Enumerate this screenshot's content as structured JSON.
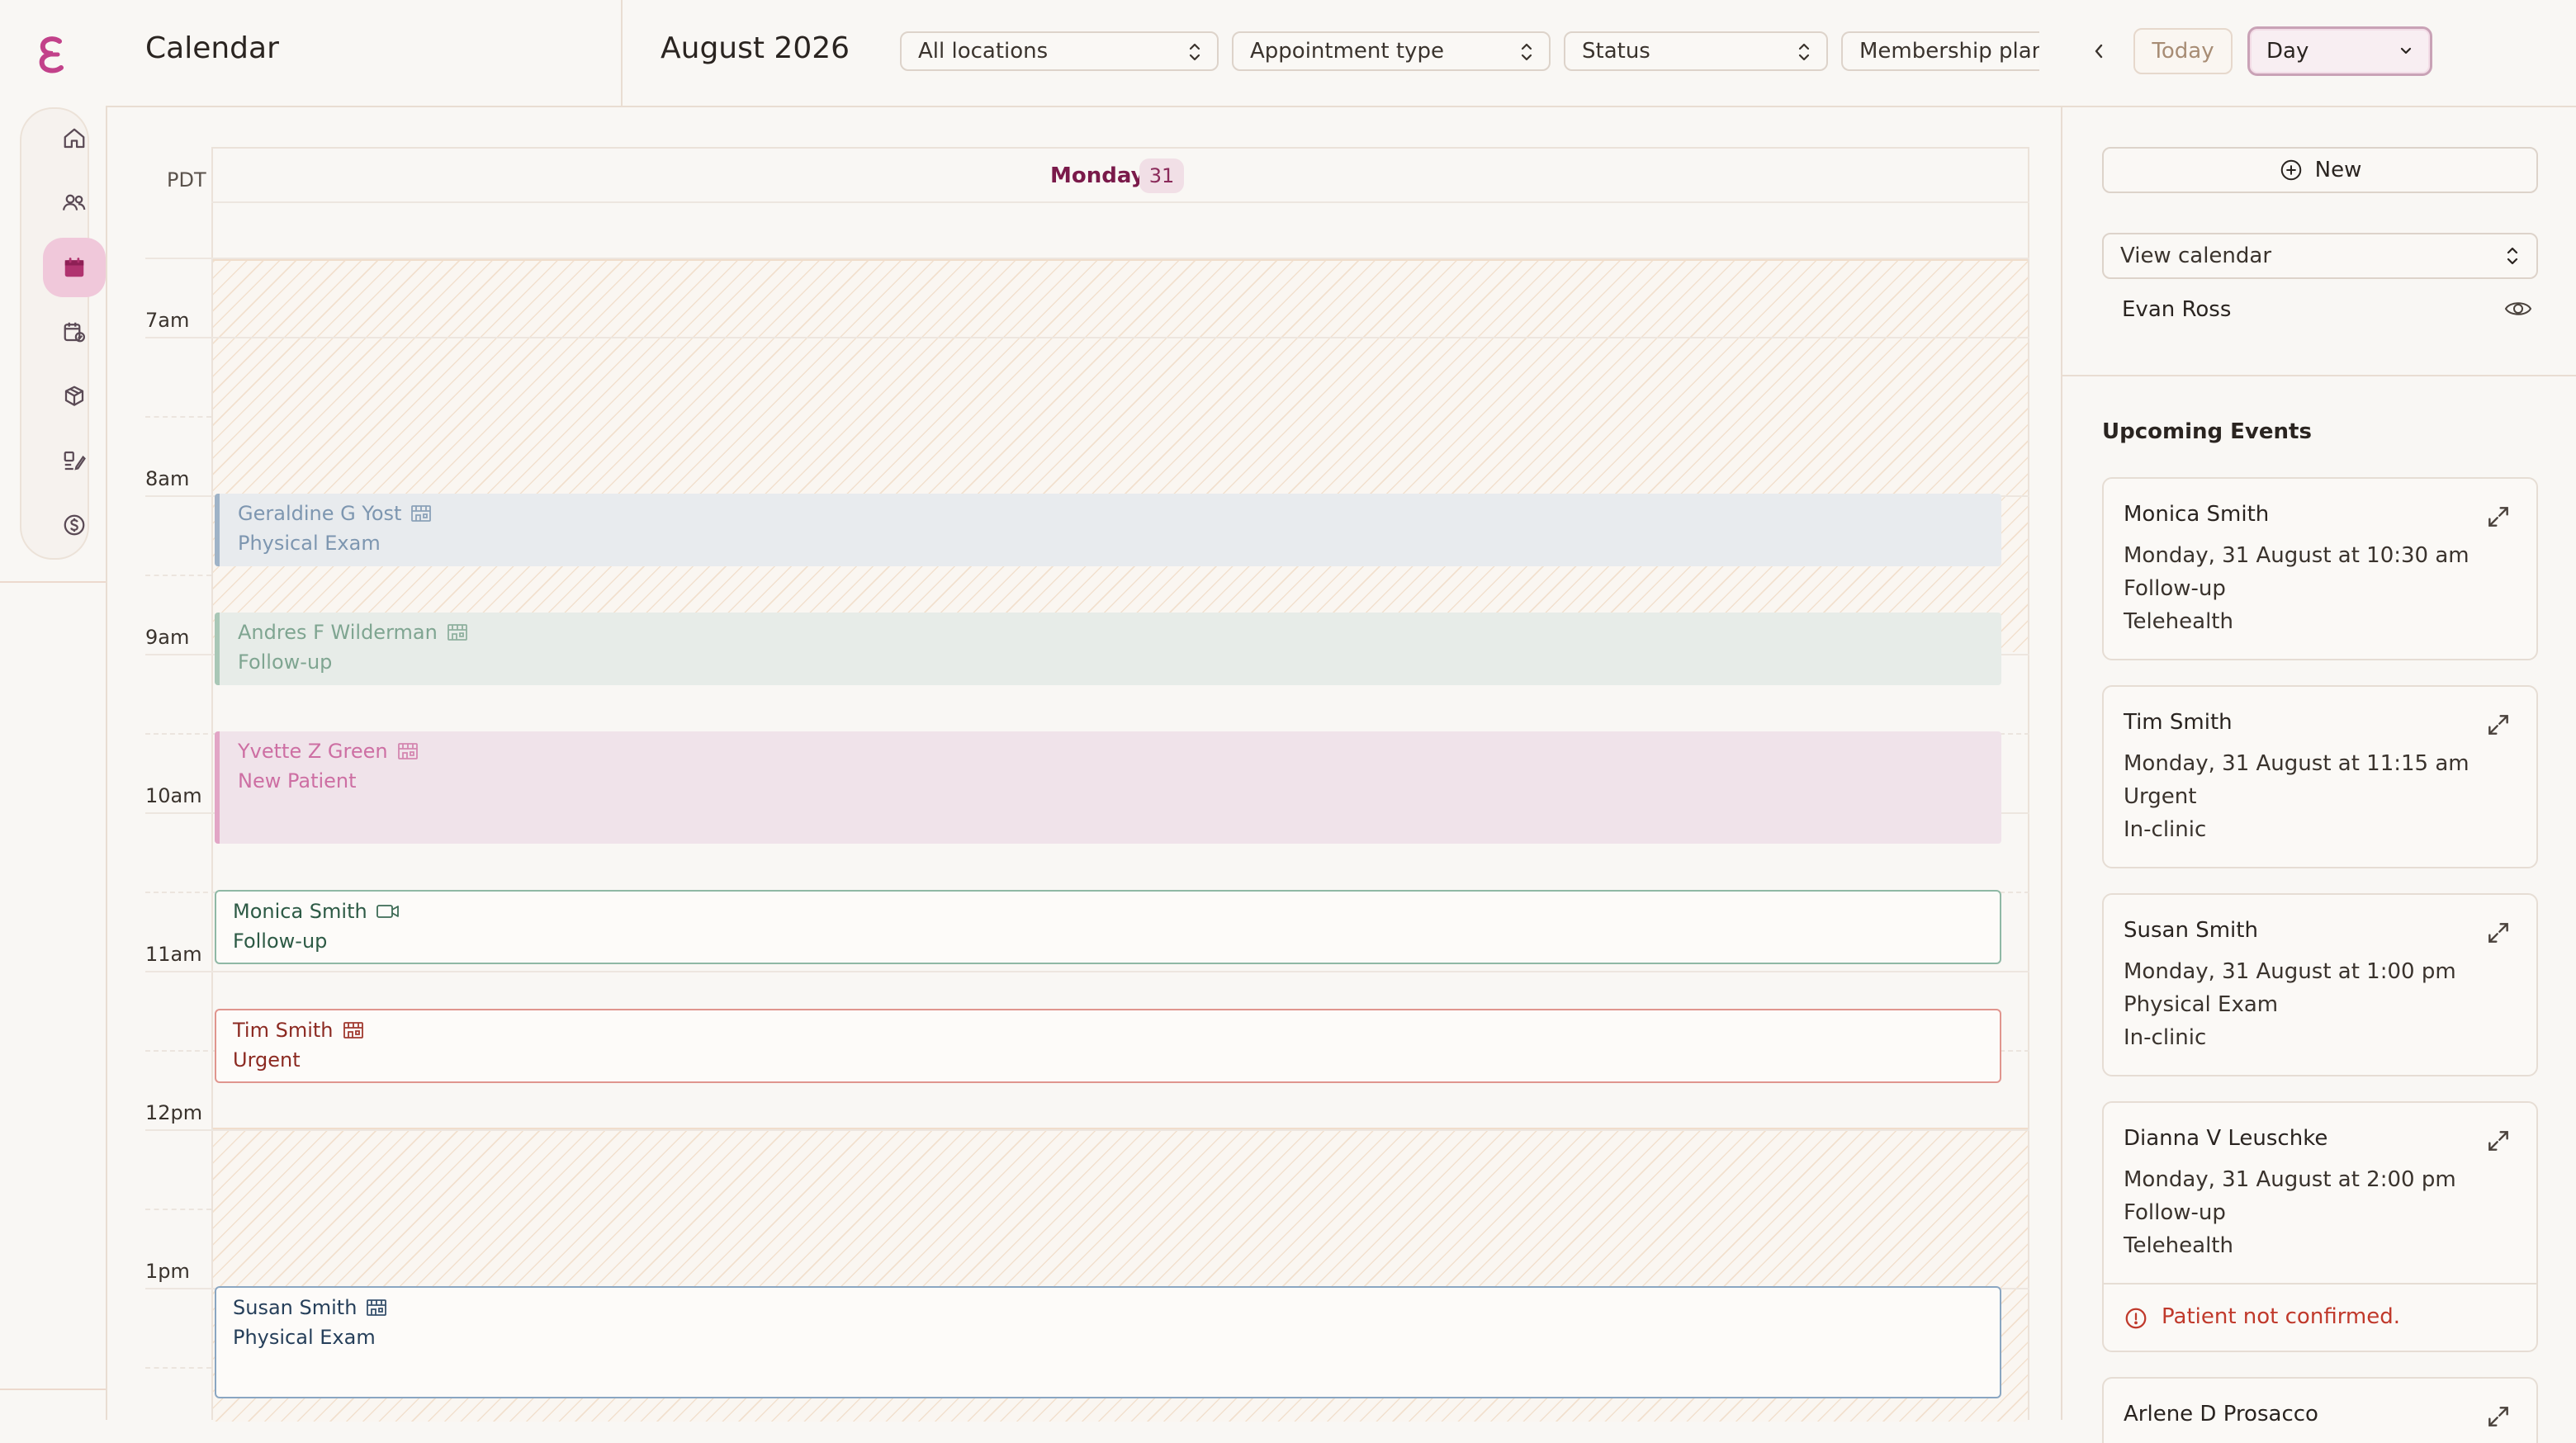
{
  "header": {
    "page_title": "Calendar",
    "month_label": "August 2026",
    "filters": {
      "locations": "All locations",
      "appointment_type": "Appointment type",
      "status": "Status",
      "membership_plan": "Membership plan"
    },
    "today_label": "Today",
    "view_mode": "Day"
  },
  "calendar": {
    "timezone": "PDT",
    "day_name": "Monday",
    "day_number": "31",
    "hours": [
      "7am",
      "8am",
      "9am",
      "10am",
      "11am",
      "12pm",
      "1pm"
    ],
    "events": [
      {
        "name": "Geraldine G Yost",
        "type": "Physical Exam",
        "mode": "in-clinic"
      },
      {
        "name": "Andres F Wilderman",
        "type": "Follow-up",
        "mode": "in-clinic"
      },
      {
        "name": "Yvette Z Green",
        "type": "New Patient",
        "mode": "in-clinic"
      },
      {
        "name": "Monica Smith",
        "type": "Follow-up",
        "mode": "video"
      },
      {
        "name": "Tim Smith",
        "type": "Urgent",
        "mode": "in-clinic"
      },
      {
        "name": "Susan Smith",
        "type": "Physical Exam",
        "mode": "in-clinic"
      }
    ]
  },
  "sidebar_panel": {
    "new_label": "New",
    "view_calendar_label": "View calendar",
    "calendar_person": "Evan Ross",
    "upcoming_title": "Upcoming Events",
    "upcoming": [
      {
        "name": "Monica Smith",
        "datetime": "Monday, 31 August at 10:30 am",
        "type": "Follow-up",
        "mode": "Telehealth"
      },
      {
        "name": "Tim Smith",
        "datetime": "Monday, 31 August at 11:15 am",
        "type": "Urgent",
        "mode": "In-clinic"
      },
      {
        "name": "Susan Smith",
        "datetime": "Monday, 31 August at 1:00 pm",
        "type": "Physical Exam",
        "mode": "In-clinic"
      },
      {
        "name": "Dianna V Leuschke",
        "datetime": "Monday, 31 August at 2:00 pm",
        "type": "Follow-up",
        "mode": "Telehealth",
        "warning": "Patient not confirmed."
      },
      {
        "name": "Arlene D Prosacco"
      }
    ]
  },
  "colors": {
    "brand": "#c2418a",
    "accent_active": "#f0c8da",
    "event_blue": "#4a6a8a",
    "event_green": "#3d6b55",
    "event_pink": "#c2418a",
    "event_red": "#b0322a",
    "warning": "#c0392b"
  }
}
